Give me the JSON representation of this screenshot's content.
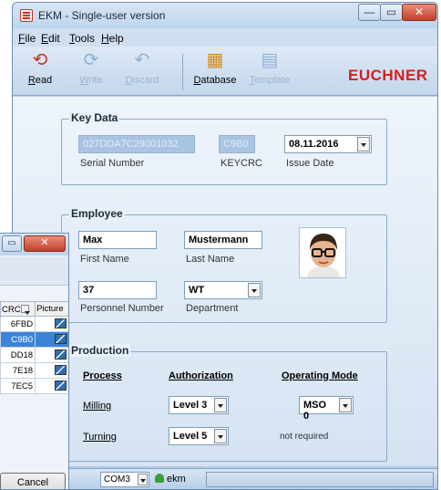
{
  "window": {
    "title": "EKM - Single-user version",
    "controls": {
      "minimize": "—",
      "maximize": "▭",
      "close": "✕"
    }
  },
  "menu": [
    "File",
    "Edit",
    "Tools",
    "Help"
  ],
  "toolbar": {
    "buttons": [
      {
        "label": "Read",
        "icon": "read-icon",
        "enabled": true
      },
      {
        "label": "Write",
        "icon": "write-icon",
        "enabled": false
      },
      {
        "label": "Discard",
        "icon": "discard-icon",
        "enabled": false
      },
      {
        "label": "Database",
        "icon": "database-icon",
        "enabled": true
      },
      {
        "label": "Template",
        "icon": "template-icon",
        "enabled": false
      }
    ],
    "logo": "EUCHNER"
  },
  "key_data": {
    "title": "Key Data",
    "serial_number": {
      "value": "027DDA7C29001032",
      "caption": "Serial Number"
    },
    "keycrc": {
      "value": "C9B0",
      "caption": "KEYCRC"
    },
    "issue_date": {
      "value": "08.11.2016",
      "caption": "Issue Date"
    }
  },
  "employee": {
    "title": "Employee",
    "first_name": {
      "value": "Max",
      "caption": "First Name"
    },
    "last_name": {
      "value": "Mustermann",
      "caption": "Last Name"
    },
    "personnel_number": {
      "value": "37",
      "caption": "Personnel Number"
    },
    "department": {
      "value": "WT",
      "caption": "Department"
    }
  },
  "production": {
    "title": "Production",
    "headers": {
      "process": "Process",
      "authorization": "Authorization",
      "operating_mode": "Operating Mode"
    },
    "rows": [
      {
        "process": "Milling",
        "authorization": "Level 3",
        "operating_mode": "MSO 0"
      },
      {
        "process": "Turning",
        "authorization": "Level 5",
        "operating_mode": "not required"
      }
    ]
  },
  "status": {
    "com_port": "COM3",
    "user": "ekm"
  },
  "background_dialog": {
    "columns": [
      "CRC",
      "Picture"
    ],
    "rows": [
      {
        "crc": "6FBD",
        "selected": false
      },
      {
        "crc": "C9B0",
        "selected": true
      },
      {
        "crc": "DD18",
        "selected": false
      },
      {
        "crc": "7E18",
        "selected": false
      },
      {
        "crc": "7EC5",
        "selected": false
      }
    ],
    "cancel_label": "Cancel"
  },
  "colors": {
    "logo": "#d81e1e",
    "selection": "#3d83d8",
    "window_border": "#6d8fb0"
  }
}
